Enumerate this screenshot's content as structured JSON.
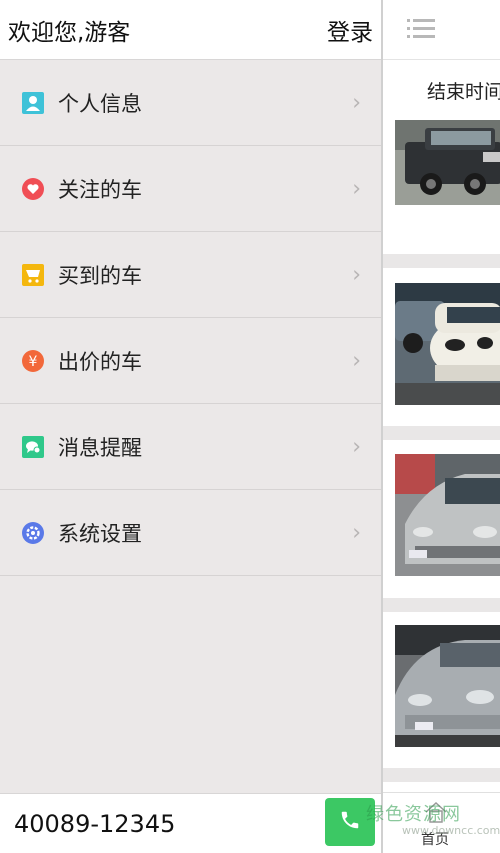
{
  "header": {
    "welcome_text": "欢迎您,游客",
    "login_label": "登录"
  },
  "menu": {
    "items": [
      {
        "label": "个人信息",
        "icon": "person-card-icon",
        "color": "#3ec2d8"
      },
      {
        "label": "关注的车",
        "icon": "heart-icon",
        "color": "#f04e55"
      },
      {
        "label": "买到的车",
        "icon": "cart-icon",
        "color": "#f4b70e"
      },
      {
        "label": "出价的车",
        "icon": "yen-icon",
        "color": "#f2683a"
      },
      {
        "label": "消息提醒",
        "icon": "chat-bubble-icon",
        "color": "#2fc88a"
      },
      {
        "label": "系统设置",
        "icon": "gear-icon",
        "color": "#5a79e8"
      }
    ]
  },
  "footer": {
    "phone_number": "40089-12345",
    "call_icon": "phone-icon",
    "call_color": "#3cc864"
  },
  "content": {
    "sort_label": "结束时间",
    "menu_icon": "hamburger-menu-icon",
    "home_label": "首页",
    "home_icon": "house-icon"
  },
  "watermark": {
    "text": "绿色资源网",
    "url": "www.downcc.com"
  }
}
